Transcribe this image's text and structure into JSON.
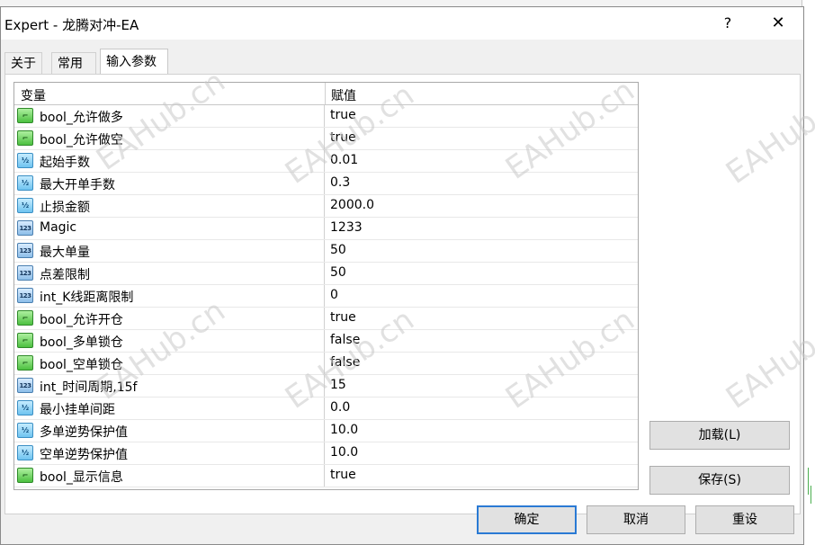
{
  "window": {
    "title": "Expert - 龙腾对冲-EA",
    "help": "?",
    "close": "✕"
  },
  "tabs": [
    {
      "label": "关于"
    },
    {
      "label": "常用"
    },
    {
      "label": "输入参数"
    }
  ],
  "grid": {
    "columns": [
      "变量",
      "赋值"
    ],
    "rows": [
      {
        "type": "bool",
        "name": "bool_允许做多",
        "value": "true"
      },
      {
        "type": "bool",
        "name": "bool_允许做空",
        "value": "true"
      },
      {
        "type": "double",
        "name": "起始手数",
        "value": "0.01"
      },
      {
        "type": "double",
        "name": "最大开单手数",
        "value": "0.3"
      },
      {
        "type": "double",
        "name": "止损金额",
        "value": "2000.0"
      },
      {
        "type": "int",
        "name": "Magic",
        "value": "1233"
      },
      {
        "type": "int",
        "name": "最大单量",
        "value": "50"
      },
      {
        "type": "int",
        "name": "点差限制",
        "value": "50"
      },
      {
        "type": "int",
        "name": "int_K线距离限制",
        "value": "0"
      },
      {
        "type": "bool",
        "name": "bool_允许开仓",
        "value": "true"
      },
      {
        "type": "bool",
        "name": "bool_多单锁仓",
        "value": "false"
      },
      {
        "type": "bool",
        "name": "bool_空单锁仓",
        "value": "false"
      },
      {
        "type": "int",
        "name": "int_时间周期,15f",
        "value": "15"
      },
      {
        "type": "double",
        "name": "最小挂单间距",
        "value": "0.0"
      },
      {
        "type": "double",
        "name": "多单逆势保护值",
        "value": "10.0"
      },
      {
        "type": "double",
        "name": "空单逆势保护值",
        "value": "10.0"
      },
      {
        "type": "bool",
        "name": "bool_显示信息",
        "value": "true"
      }
    ]
  },
  "icons": {
    "bool": "bool-icon",
    "double": "double-icon",
    "int": "int-icon",
    "bool_glyph": "⌐",
    "double_glyph": "½",
    "int_glyph": "123"
  },
  "buttons": {
    "load": "加载(L)",
    "save": "保存(S)",
    "ok": "确定",
    "cancel": "取消",
    "reset": "重设"
  },
  "watermark": "EAHub.cn",
  "colors": {
    "accent": "#2a7ad4",
    "bool_icon": "#4cc040",
    "double_icon": "#6ec3f0"
  }
}
